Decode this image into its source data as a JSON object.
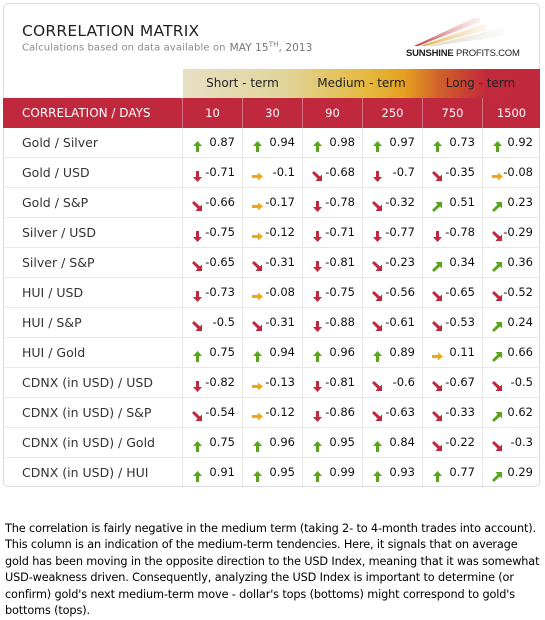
{
  "header": {
    "title": "CORRELATION MATRIX",
    "subtitle": "Calculations based on data available on",
    "date_prefix": "MAY 15",
    "date_sup": "TH",
    "date_suffix": ", 2013",
    "logo_bold": "SUNSHINE",
    "logo_rest": " PROFITS.COM"
  },
  "term_groups": [
    "Short - term",
    "Medium - term",
    "Long - term"
  ],
  "table": {
    "corner_label": "CORRELATION / DAYS",
    "columns": [
      "10",
      "30",
      "90",
      "250",
      "750",
      "1500"
    ],
    "arrow_colors": {
      "up": "#5aa51e",
      "up-right": "#5aa51e",
      "right": "#eca81c",
      "down-right": "#c0283d",
      "down": "#c0283d"
    },
    "rows": [
      {
        "label": "Gold / Silver",
        "cells": [
          {
            "v": "0.87",
            "a": "up"
          },
          {
            "v": "0.94",
            "a": "up"
          },
          {
            "v": "0.98",
            "a": "up"
          },
          {
            "v": "0.97",
            "a": "up"
          },
          {
            "v": "0.73",
            "a": "up"
          },
          {
            "v": "0.92",
            "a": "up"
          }
        ]
      },
      {
        "label": "Gold / USD",
        "cells": [
          {
            "v": "-0.71",
            "a": "down"
          },
          {
            "v": "-0.1",
            "a": "right"
          },
          {
            "v": "-0.68",
            "a": "down-right"
          },
          {
            "v": "-0.7",
            "a": "down"
          },
          {
            "v": "-0.35",
            "a": "down-right"
          },
          {
            "v": "-0.08",
            "a": "right"
          }
        ]
      },
      {
        "label": "Gold / S&P",
        "cells": [
          {
            "v": "-0.66",
            "a": "down-right"
          },
          {
            "v": "-0.17",
            "a": "right"
          },
          {
            "v": "-0.78",
            "a": "down"
          },
          {
            "v": "-0.32",
            "a": "down-right"
          },
          {
            "v": "0.51",
            "a": "up-right"
          },
          {
            "v": "0.23",
            "a": "up-right"
          }
        ]
      },
      {
        "label": "Silver / USD",
        "cells": [
          {
            "v": "-0.75",
            "a": "down"
          },
          {
            "v": "-0.12",
            "a": "right"
          },
          {
            "v": "-0.71",
            "a": "down"
          },
          {
            "v": "-0.77",
            "a": "down"
          },
          {
            "v": "-0.78",
            "a": "down"
          },
          {
            "v": "-0.29",
            "a": "down-right"
          }
        ]
      },
      {
        "label": "Silver / S&P",
        "cells": [
          {
            "v": "-0.65",
            "a": "down-right"
          },
          {
            "v": "-0.31",
            "a": "down-right"
          },
          {
            "v": "-0.81",
            "a": "down"
          },
          {
            "v": "-0.23",
            "a": "down-right"
          },
          {
            "v": "0.34",
            "a": "up-right"
          },
          {
            "v": "0.36",
            "a": "up-right"
          }
        ]
      },
      {
        "label": "HUI / USD",
        "cells": [
          {
            "v": "-0.73",
            "a": "down"
          },
          {
            "v": "-0.08",
            "a": "right"
          },
          {
            "v": "-0.75",
            "a": "down"
          },
          {
            "v": "-0.56",
            "a": "down-right"
          },
          {
            "v": "-0.65",
            "a": "down-right"
          },
          {
            "v": "-0.52",
            "a": "down-right"
          }
        ]
      },
      {
        "label": "HUI / S&P",
        "cells": [
          {
            "v": "-0.5",
            "a": "down-right"
          },
          {
            "v": "-0.31",
            "a": "down-right"
          },
          {
            "v": "-0.88",
            "a": "down"
          },
          {
            "v": "-0.61",
            "a": "down-right"
          },
          {
            "v": "-0.53",
            "a": "down-right"
          },
          {
            "v": "0.24",
            "a": "up-right"
          }
        ]
      },
      {
        "label": "HUI / Gold",
        "cells": [
          {
            "v": "0.75",
            "a": "up"
          },
          {
            "v": "0.94",
            "a": "up"
          },
          {
            "v": "0.96",
            "a": "up"
          },
          {
            "v": "0.89",
            "a": "up"
          },
          {
            "v": "0.11",
            "a": "right"
          },
          {
            "v": "0.66",
            "a": "up-right"
          }
        ]
      },
      {
        "label": "CDNX (in USD) / USD",
        "cells": [
          {
            "v": "-0.82",
            "a": "down"
          },
          {
            "v": "-0.13",
            "a": "right"
          },
          {
            "v": "-0.81",
            "a": "down"
          },
          {
            "v": "-0.6",
            "a": "down-right"
          },
          {
            "v": "-0.67",
            "a": "down-right"
          },
          {
            "v": "-0.5",
            "a": "down-right"
          }
        ]
      },
      {
        "label": "CDNX (in USD) / S&P",
        "cells": [
          {
            "v": "-0.54",
            "a": "down-right"
          },
          {
            "v": "-0.12",
            "a": "right"
          },
          {
            "v": "-0.86",
            "a": "down"
          },
          {
            "v": "-0.63",
            "a": "down-right"
          },
          {
            "v": "-0.33",
            "a": "down-right"
          },
          {
            "v": "0.62",
            "a": "up-right"
          }
        ]
      },
      {
        "label": "CDNX (in USD) / Gold",
        "cells": [
          {
            "v": "0.75",
            "a": "up"
          },
          {
            "v": "0.96",
            "a": "up"
          },
          {
            "v": "0.95",
            "a": "up"
          },
          {
            "v": "0.84",
            "a": "up"
          },
          {
            "v": "-0.22",
            "a": "down-right"
          },
          {
            "v": "-0.3",
            "a": "down-right"
          }
        ]
      },
      {
        "label": "CDNX (in USD) / HUI",
        "cells": [
          {
            "v": "0.91",
            "a": "up"
          },
          {
            "v": "0.95",
            "a": "up"
          },
          {
            "v": "0.99",
            "a": "up"
          },
          {
            "v": "0.93",
            "a": "up"
          },
          {
            "v": "0.77",
            "a": "up"
          },
          {
            "v": "0.29",
            "a": "up-right"
          }
        ]
      }
    ]
  },
  "description": "The correlation is fairly negative in the medium term (taking 2- to 4-month trades into account). This column is an indication of the medium-term tendencies. Here, it signals that on average gold has been moving in the opposite direction to the USD Index, meaning that it was somewhat USD-weakness driven. Consequently, analyzing the USD Index is important to determine (or confirm) gold's next medium-term move - dollar's tops (bottoms) might correspond to gold's bottoms (tops)."
}
